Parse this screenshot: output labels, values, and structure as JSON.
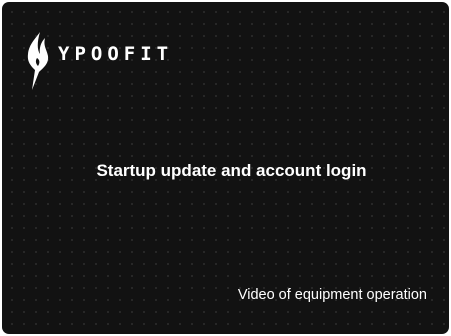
{
  "brand": {
    "logo_icon": "flame-blade-icon",
    "name": "YPOOFIT"
  },
  "main": {
    "title": "Startup update and account login",
    "subtitle": "Video of equipment operation"
  },
  "colors": {
    "background": "#121212",
    "text": "#ffffff"
  }
}
